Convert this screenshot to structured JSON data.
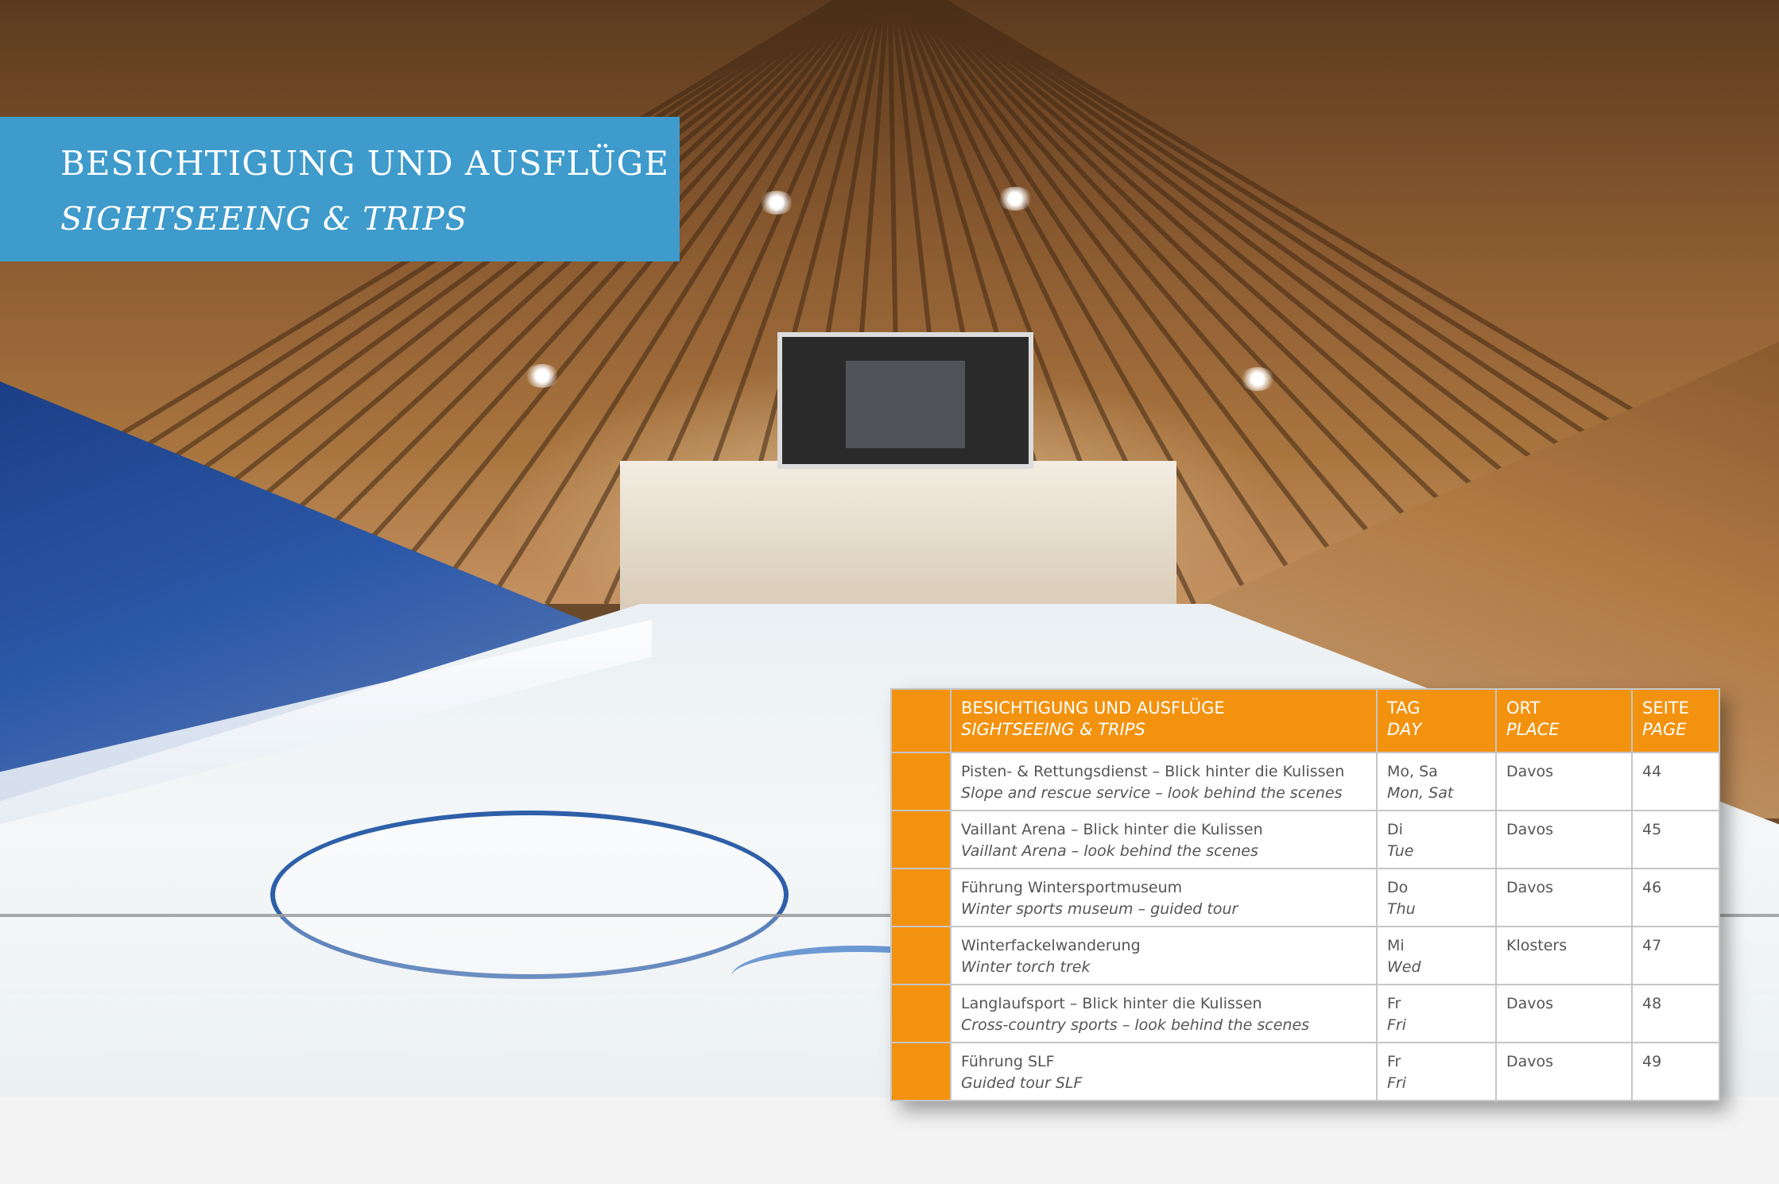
{
  "banner": {
    "title_de": "BESICHTIGUNG UND AUSFLÜGE",
    "title_en": "SIGHTSEEING & TRIPS"
  },
  "table": {
    "header": {
      "activity_de": "BESICHTIGUNG UND AUSFLÜGE",
      "activity_en": "SIGHTSEEING & TRIPS",
      "day_de": "TAG",
      "day_en": "DAY",
      "place_de": "ORT",
      "place_en": "PLACE",
      "page_de": "SEITE",
      "page_en": "PAGE"
    },
    "rows": [
      {
        "activity_de": "Pisten- & Rettungsdienst – Blick hinter die Kulissen",
        "activity_en": "Slope and rescue service – look behind the scenes",
        "day_de": "Mo, Sa",
        "day_en": "Mon, Sat",
        "place": "Davos",
        "page": "44"
      },
      {
        "activity_de": "Vaillant Arena – Blick hinter die Kulissen",
        "activity_en": "Vaillant Arena – look behind the scenes",
        "day_de": "Di",
        "day_en": "Tue",
        "place": "Davos",
        "page": "45"
      },
      {
        "activity_de": "Führung Wintersportmuseum",
        "activity_en": "Winter sports museum – guided tour",
        "day_de": "Do",
        "day_en": "Thu",
        "place": "Davos",
        "page": "46"
      },
      {
        "activity_de": "Winterfackelwanderung",
        "activity_en": "Winter torch trek",
        "day_de": "Mi",
        "day_en": "Wed",
        "place": "Klosters",
        "page": "47"
      },
      {
        "activity_de": "Langlaufsport – Blick hinter die Kulissen",
        "activity_en": "Cross-country sports – look behind the scenes",
        "day_de": "Fr",
        "day_en": "Fri",
        "place": "Davos",
        "page": "48"
      },
      {
        "activity_de": "Führung SLF",
        "activity_en": "Guided tour SLF",
        "day_de": "Fr",
        "day_en": "Fri",
        "place": "Davos",
        "page": "49"
      }
    ]
  },
  "colors": {
    "banner_blue": "#3e9bcb",
    "header_orange": "#f3920f"
  }
}
